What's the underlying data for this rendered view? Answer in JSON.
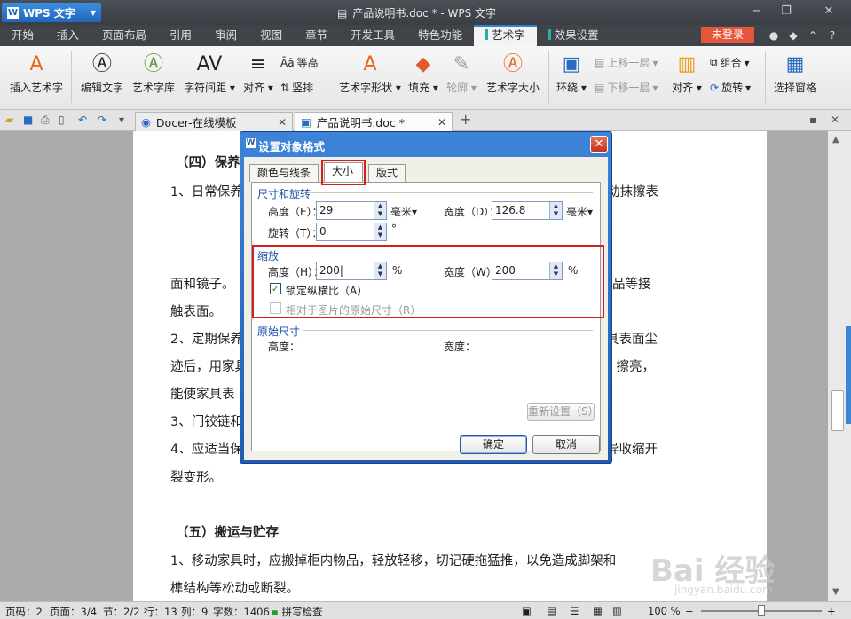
{
  "app": {
    "name": "WPS 文字",
    "title": "产品说明书.doc * - WPS 文字"
  },
  "menu": {
    "tabs": [
      "开始",
      "插入",
      "页面布局",
      "引用",
      "审阅",
      "视图",
      "章节",
      "开发工具",
      "特色功能",
      "艺术字",
      "效果设置"
    ],
    "active": "艺术字",
    "login": "未登录"
  },
  "ribbon": {
    "insert_art": "插入艺术字",
    "edit_text": "编辑文字",
    "art_lib": "艺术字库",
    "char_spacing": "字符间距",
    "align": "对齐",
    "equal_height": "等高",
    "vertical": "竖排",
    "art_shape": "艺术字形状",
    "fill": "填充",
    "outline": "轮廓",
    "art_size": "艺术字大小",
    "wrap": "环绕",
    "bring_forward": "上移一层",
    "send_backward": "下移一层",
    "align2": "对齐",
    "group": "组合",
    "rotate": "旋转",
    "selection_pane": "选择窗格"
  },
  "tabs": [
    {
      "label": "Docer-在线模板"
    },
    {
      "label": "产品说明书.doc *"
    }
  ],
  "doc": {
    "lines": [
      "（四）保养",
      "1、日常保养",
      "面和镜子。",
      "触表面。",
      "2、定期保养",
      "迹后，用家具",
      "能使家具表",
      "3、门铰链和",
      "4、应适当保",
      "裂变形。",
      "（五）搬运与贮存",
      "1、移动家具时，应搬掉柜内物品，轻放轻移，切记硬拖猛推，以免造成脚架和",
      "榫结构等松动或断裂。"
    ],
    "right_frag": [
      "动抹擦表",
      "品等接",
      "具表面尘",
      "）擦亮，",
      "异收缩开"
    ]
  },
  "dialog": {
    "title": "设置对象格式",
    "tabs": [
      "颜色与线条",
      "大小",
      "版式"
    ],
    "active_tab": "大小",
    "size_rotate": {
      "label": "尺寸和旋转",
      "height_label": "高度（E）：",
      "height_value": "29",
      "height_unit": "毫米",
      "width_label": "宽度（D）：",
      "width_value": "126.8",
      "width_unit": "毫米",
      "rotate_label": "旋转（T）：",
      "rotate_value": "0",
      "rotate_unit": "°"
    },
    "scale": {
      "label": "缩放",
      "height_label": "高度（H）：",
      "height_value": "200",
      "width_label": "宽度（W）：",
      "width_value": "200",
      "unit": "%",
      "lock_ratio": "锁定纵横比（A）",
      "lock_checked": true,
      "relative": "相对于图片的原始尺寸（R）",
      "relative_checked": false
    },
    "original": {
      "label": "原始尺寸",
      "height_label": "高度：",
      "width_label": "宽度："
    },
    "reset": "重新设置（S）",
    "ok": "确定",
    "cancel": "取消"
  },
  "status": {
    "page": "页码：2",
    "pages": "页面：3/4",
    "section": "节：2/2",
    "row": "行：13",
    "col": "列：9",
    "words": "字数：1406",
    "spell": "拼写检查",
    "zoom": "100 %"
  },
  "watermark": {
    "logo": "Bai 经验",
    "url": "jingyan.baidu.com"
  }
}
